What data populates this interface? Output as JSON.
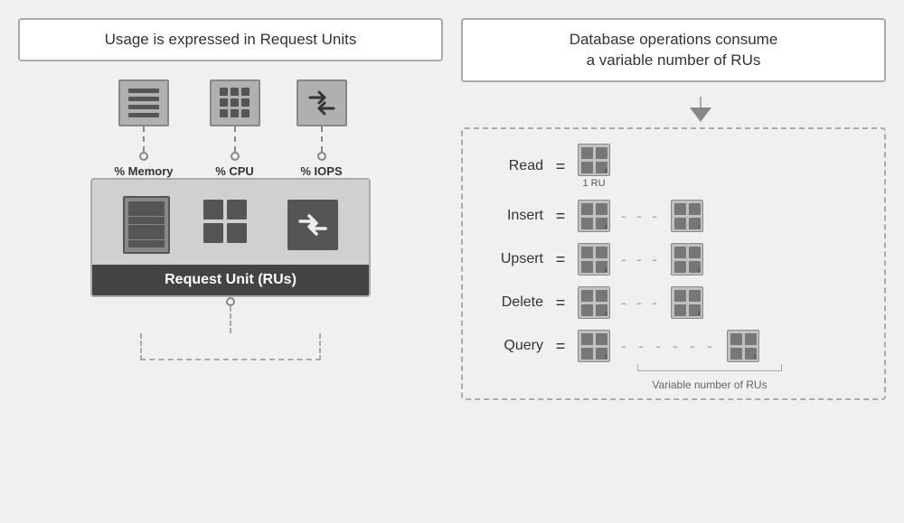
{
  "left_panel": {
    "title": "Usage is expressed in Request Units",
    "metrics": [
      {
        "label": "% Memory"
      },
      {
        "label": "% CPU"
      },
      {
        "label": "% IOPS"
      }
    ],
    "ru_label": "Request Unit (RUs)"
  },
  "right_panel": {
    "title": "Database operations consume\na variable number of RUs",
    "operations": [
      {
        "label": "Read",
        "equals": "=",
        "dashes": false,
        "one_ru": "1 RU"
      },
      {
        "label": "Insert",
        "equals": "=",
        "dashes": true
      },
      {
        "label": "Upsert",
        "equals": "=",
        "dashes": true
      },
      {
        "label": "Delete",
        "equals": "=",
        "dashes": true
      },
      {
        "label": "Query",
        "equals": "=",
        "dashes": true,
        "long_dashes": true
      }
    ],
    "variable_label": "Variable number of RUs"
  }
}
